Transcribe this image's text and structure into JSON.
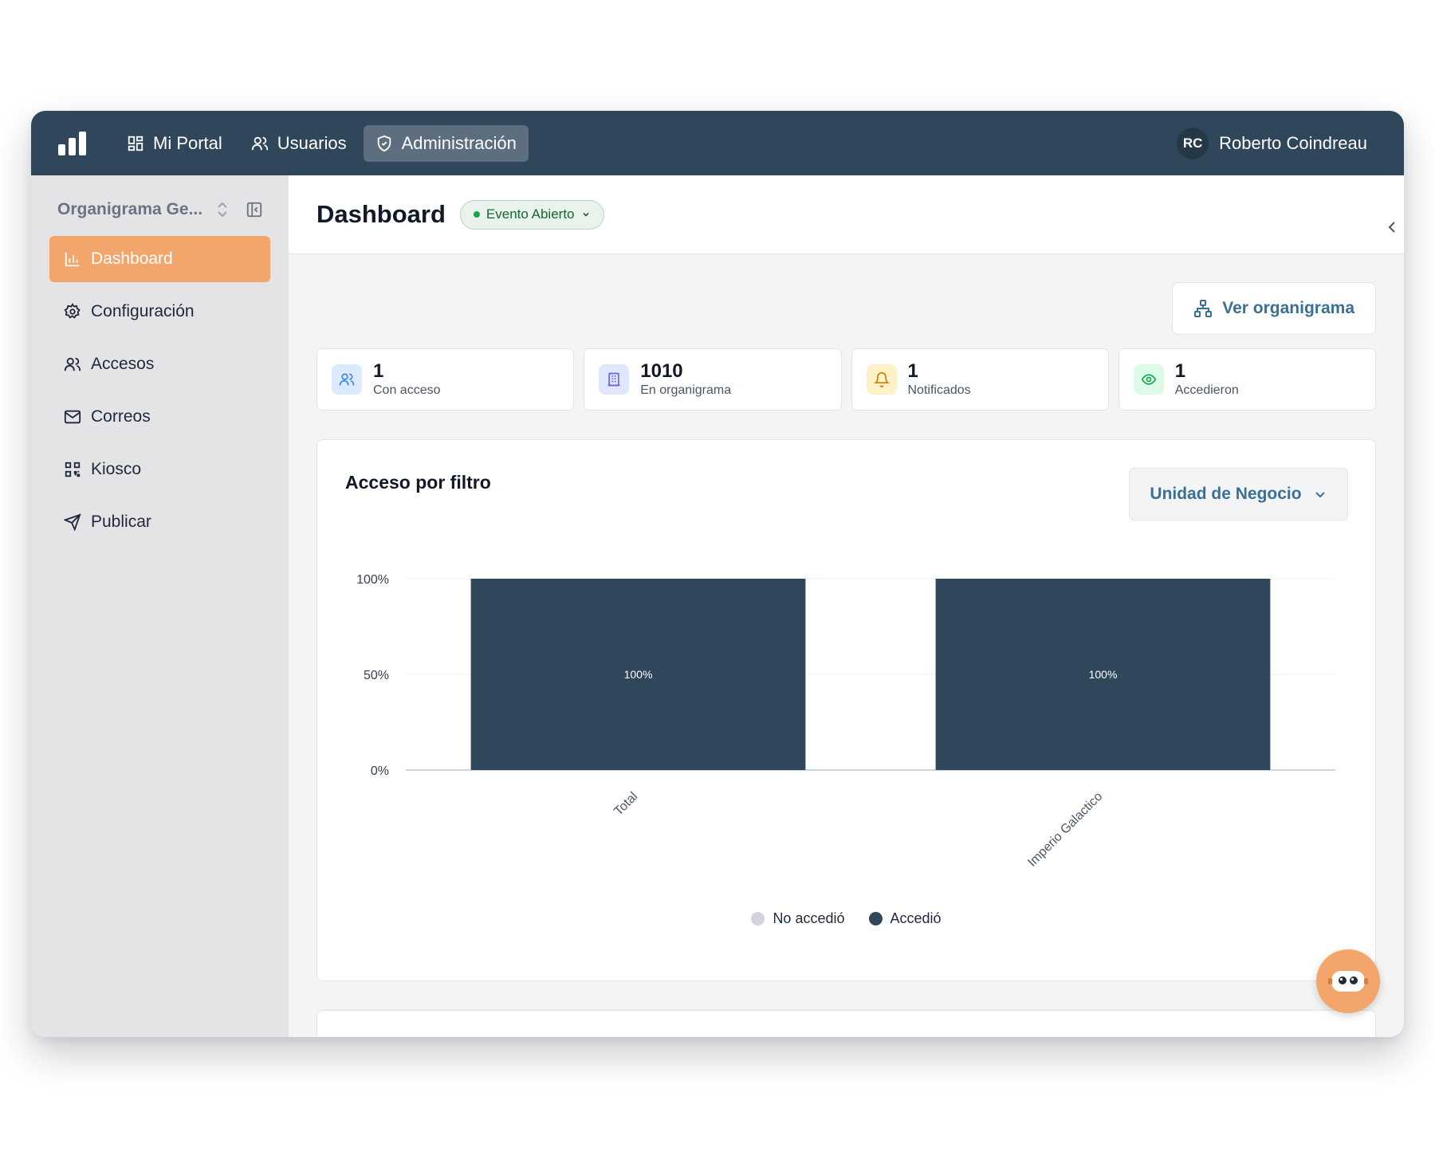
{
  "topbar": {
    "nav": [
      {
        "label": "Mi Portal",
        "icon": "grid-icon"
      },
      {
        "label": "Usuarios",
        "icon": "users-icon"
      },
      {
        "label": "Administración",
        "icon": "shield-icon",
        "active": true
      }
    ],
    "user": {
      "initials": "RC",
      "name": "Roberto Coindreau"
    }
  },
  "sidebar": {
    "title": "Organigrama Ge...",
    "items": [
      {
        "label": "Dashboard",
        "icon": "bar-chart-icon",
        "active": true
      },
      {
        "label": "Configuración",
        "icon": "gear-icon"
      },
      {
        "label": "Accesos",
        "icon": "users-icon"
      },
      {
        "label": "Correos",
        "icon": "mail-icon"
      },
      {
        "label": "Kiosco",
        "icon": "qr-code-icon"
      },
      {
        "label": "Publicar",
        "icon": "send-icon"
      }
    ]
  },
  "header": {
    "title": "Dashboard",
    "status": "Evento Abierto"
  },
  "actions": {
    "org_button": "Ver organigrama"
  },
  "stats": [
    {
      "value": "1",
      "label": "Con acceso",
      "icon": "users-icon",
      "color": "#3b82f6"
    },
    {
      "value": "1010",
      "label": "En organigrama",
      "icon": "building-icon",
      "color": "#6366f1"
    },
    {
      "value": "1",
      "label": "Notificados",
      "icon": "bell-icon",
      "color": "#d97706"
    },
    {
      "value": "1",
      "label": "Accedieron",
      "icon": "eye-icon",
      "color": "#16a34a"
    }
  ],
  "chart_card": {
    "title": "Acceso por filtro",
    "filter_label": "Unidad de Negocio"
  },
  "chart_data": {
    "type": "bar",
    "stacked": true,
    "categories": [
      "Total",
      "Imperio Galactico"
    ],
    "series": [
      {
        "name": "No accedió",
        "values": [
          0,
          0
        ],
        "color": "#d1d5db"
      },
      {
        "name": "Accedió",
        "values": [
          100,
          100
        ],
        "color": "#30475b"
      }
    ],
    "data_labels": [
      "100%",
      "100%"
    ],
    "yticks": [
      "0%",
      "50%",
      "100%"
    ],
    "ylim": [
      0,
      100
    ],
    "legend": "bottom",
    "grid": true
  },
  "colors": {
    "nav": "#30475b",
    "accent": "#f3a66c",
    "link": "#3a6f96"
  }
}
